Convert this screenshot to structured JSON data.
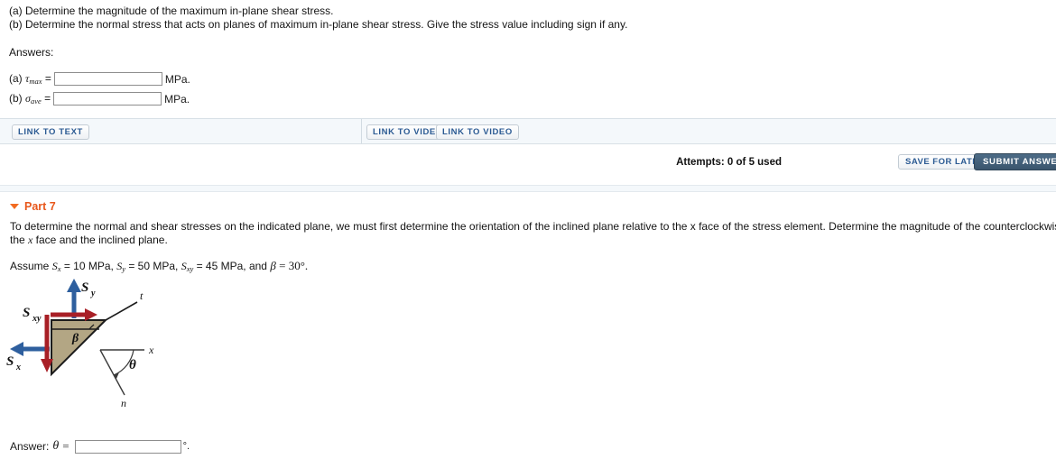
{
  "question": {
    "line_a": "(a) Determine the magnitude of the maximum in-plane shear stress.",
    "line_b": "(b) Determine the normal stress that acts on planes of maximum in-plane shear stress. Give the stress value including sign if any.",
    "answers_label": "Answers:",
    "fields": [
      {
        "prefix": "(a)",
        "symbol": "τ",
        "subscript": "max",
        "equals": "=",
        "value": "",
        "unit": "MPa."
      },
      {
        "prefix": "(b)",
        "symbol": "σ",
        "subscript": "ave",
        "equals": "=",
        "value": "",
        "unit": "MPa."
      }
    ]
  },
  "toolbar": {
    "link_to_text": "LINK TO TEXT",
    "link_to_video_1": "LINK TO VIDEO",
    "link_to_video_2": "LINK TO VIDEO"
  },
  "submit_row": {
    "attempts": "Attempts: 0 of 5 used",
    "save_for_later": "SAVE FOR LATER",
    "submit_answer": "SUBMIT ANSWER"
  },
  "part": {
    "title": "Part 7",
    "paragraph": "To determine the normal and shear stresses on the indicated plane, we must first determine the orientation of the inclined plane relative to the x face of the stress element. Determine the magnitude of the counterclockwise angle θ between",
    "paragraph_line2": "the x face and the inclined plane.",
    "assume": {
      "lead": "Assume",
      "sx_symbol": "S",
      "sx_sub": "x",
      "sx_value": "= 10 MPa,",
      "sy_symbol": "S",
      "sy_sub": "y",
      "sy_value": "= 50 MPa,",
      "sxy_symbol": "S",
      "sxy_sub": "xy",
      "sxy_value": "= 45 MPa, and",
      "beta_symbol": "β",
      "beta_value": "= 30°."
    }
  },
  "figure": {
    "name": "inclined-plane-stress-element-diagram",
    "labels": {
      "sy": "S",
      "sy_sub": "y",
      "sx": "S",
      "sx_sub": "x",
      "sxy": "S",
      "sxy_sub": "xy",
      "beta": "β",
      "theta": "θ",
      "axis_t": "t",
      "axis_x": "x",
      "axis_n": "n"
    },
    "colors": {
      "wedge_fill": "#b3a684",
      "wedge_stroke": "#1c1c1c",
      "normal_stress_arrow": "#2e5f9e",
      "shear_stress_arrow": "#a81f26",
      "axis": "#3a3a3a"
    }
  },
  "bottom_answer": {
    "label": "Answer:",
    "symbol": "θ",
    "equals": "=",
    "value": "",
    "unit": "°."
  }
}
